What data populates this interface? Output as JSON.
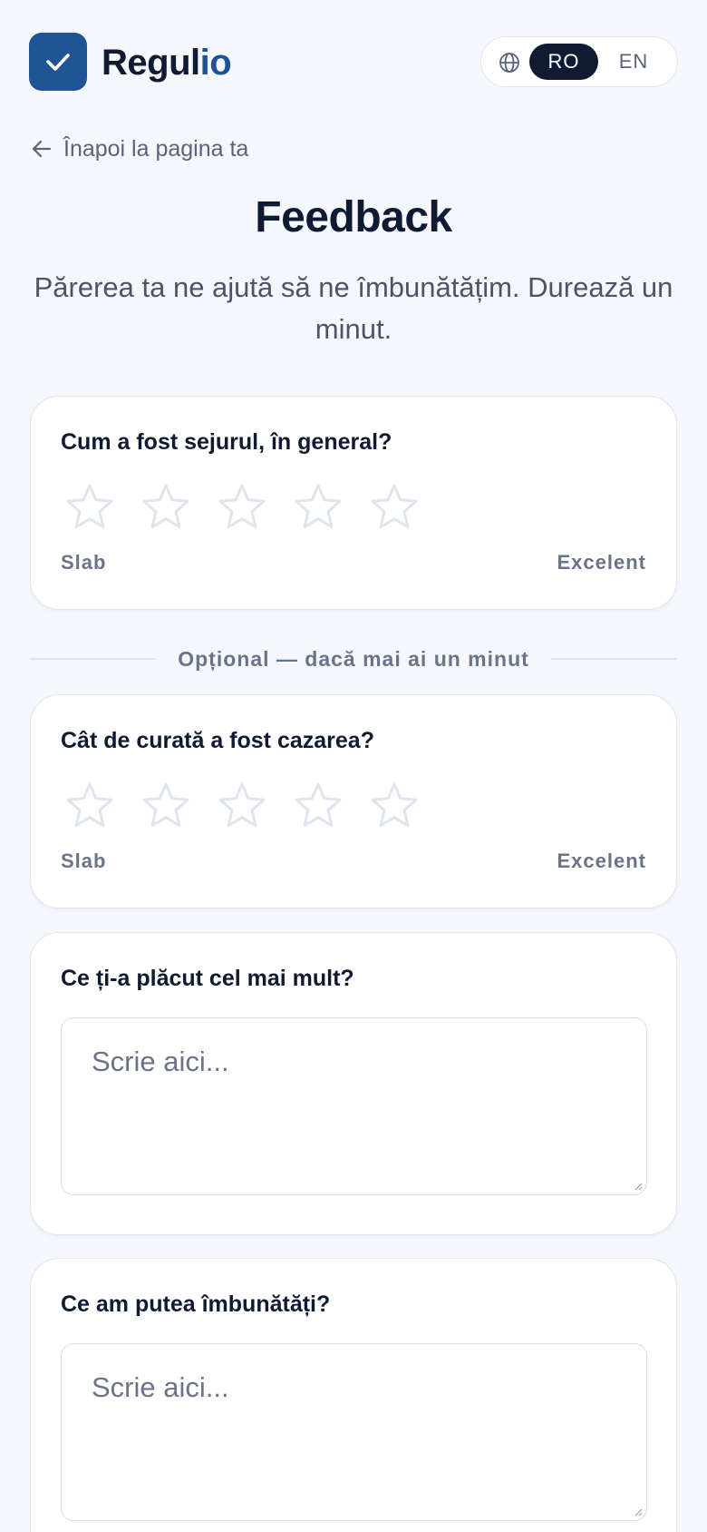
{
  "brand": {
    "name_main": "Regul",
    "name_accent": "io",
    "accent_color": "#1e5494"
  },
  "language": {
    "options": [
      "RO",
      "EN"
    ],
    "selected": "RO",
    "icon": "globe-icon"
  },
  "back_link": {
    "label": "Înapoi la pagina ta",
    "icon": "arrow-left-icon"
  },
  "page": {
    "title": "Feedback",
    "subtitle": "Părerea ta ne ajută să ne îmbunătățim. Durează un minut."
  },
  "rating_overall": {
    "question": "Cum a fost sejurul, în general?",
    "rating": 0,
    "max": 5,
    "low_label": "Slab",
    "high_label": "Excelent"
  },
  "optional_divider": "Opțional — dacă mai ai un minut",
  "rating_cleanliness": {
    "question": "Cât de curată a fost cazarea?",
    "rating": 0,
    "max": 5,
    "low_label": "Slab",
    "high_label": "Excelent"
  },
  "liked_most": {
    "question": "Ce ți-a plăcut cel mai mult?",
    "placeholder": "Scrie aici...",
    "value": ""
  },
  "improve": {
    "question": "Ce am putea îmbunătăți?",
    "placeholder": "Scrie aici...",
    "value": ""
  }
}
